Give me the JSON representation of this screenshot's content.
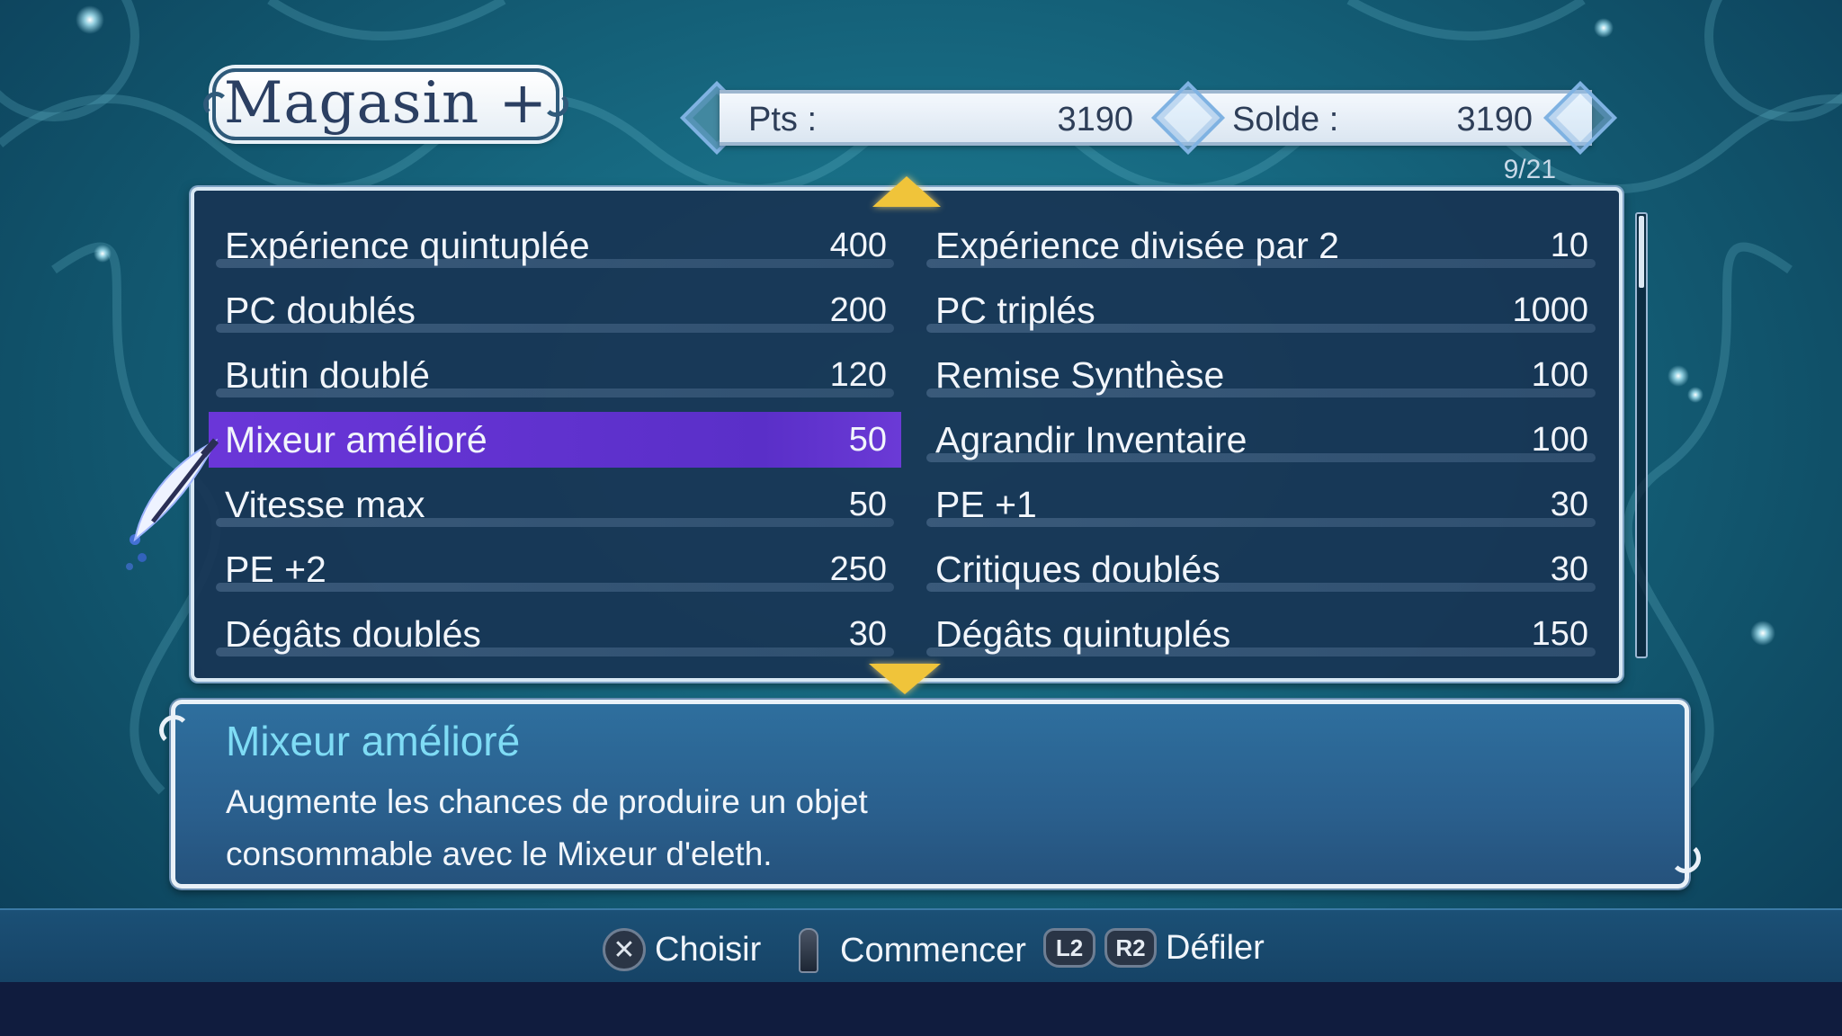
{
  "header": {
    "title": "Magasin +",
    "points_label": "Pts :",
    "points_value": "3190",
    "balance_label": "Solde :",
    "balance_value": "3190",
    "page": "9/21"
  },
  "shop": {
    "selected_index": 3,
    "left": [
      {
        "name": "Expérience quintuplée",
        "cost": "400"
      },
      {
        "name": "PC doublés",
        "cost": "200"
      },
      {
        "name": "Butin doublé",
        "cost": "120"
      },
      {
        "name": "Mixeur amélioré",
        "cost": "50"
      },
      {
        "name": "Vitesse max",
        "cost": "50"
      },
      {
        "name": "PE +2",
        "cost": "250"
      },
      {
        "name": "Dégâts doublés",
        "cost": "30"
      }
    ],
    "right": [
      {
        "name": "Expérience divisée par 2",
        "cost": "10"
      },
      {
        "name": "PC triplés",
        "cost": "1000"
      },
      {
        "name": "Remise Synthèse",
        "cost": "100"
      },
      {
        "name": "Agrandir Inventaire",
        "cost": "100"
      },
      {
        "name": "PE +1",
        "cost": "30"
      },
      {
        "name": "Critiques doublés",
        "cost": "30"
      },
      {
        "name": "Dégâts quintuplés",
        "cost": "150"
      }
    ]
  },
  "description": {
    "title": "Mixeur amélioré",
    "line1": "Augmente les chances de produire un objet",
    "line2": "consommable avec le Mixeur d'eleth."
  },
  "controls": {
    "choose_icon": "cross-button-icon",
    "choose_label": "Choisir",
    "start_icon": "stick-button-icon",
    "start_label": "Commencer",
    "l2_text": "L2",
    "r2_text": "R2",
    "scroll_label": "Défiler"
  },
  "colors": {
    "selection": "#5a2fc8",
    "description_title": "#7fdcf5",
    "arrow": "#f0c43a"
  }
}
